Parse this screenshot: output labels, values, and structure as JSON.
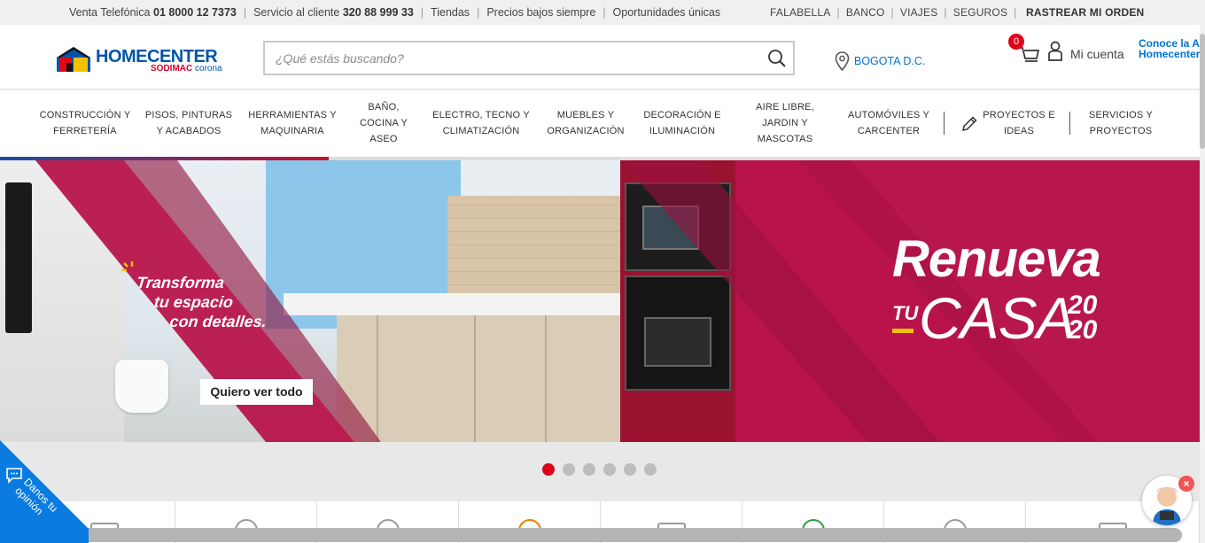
{
  "topbar": {
    "venta_label": "Venta Telefónica",
    "venta_number": "01 8000 12 7373",
    "servicio_label": "Servicio al cliente",
    "servicio_number": "320 88 999 33",
    "tiendas": "Tiendas",
    "precios": "Precios bajos siempre",
    "oportunidades": "Oportunidades únicas",
    "falabella": "FALABELLA",
    "banco": "BANCO",
    "viajes": "VIAJES",
    "seguros": "SEGUROS",
    "rastrear": "RASTREAR MI ORDEN"
  },
  "header": {
    "brand": "HOMECENTER",
    "brand_sub_1": "SODIMAC",
    "brand_sub_2": "corona",
    "search_placeholder": "¿Qué estás buscando?",
    "location": "BOGOTA D.C.",
    "cart_count": "0",
    "account": "Mi cuenta",
    "conoce_line1": "Conoce la A",
    "conoce_line2": "Homecenter"
  },
  "nav": {
    "items": [
      {
        "l1": "CONSTRUCCIÓN Y",
        "l2": "FERRETERÍA",
        "l3": ""
      },
      {
        "l1": "PISOS, PINTURAS",
        "l2": "Y ACABADOS",
        "l3": ""
      },
      {
        "l1": "HERRAMIENTAS Y",
        "l2": "MAQUINARIA",
        "l3": ""
      },
      {
        "l1": "BAÑO,",
        "l2": "COCINA Y",
        "l3": "ASEO"
      },
      {
        "l1": "ELECTRO, TECNO Y",
        "l2": "CLIMATIZACIÓN",
        "l3": ""
      },
      {
        "l1": "MUEBLES Y",
        "l2": "ORGANIZACIÓN",
        "l3": ""
      },
      {
        "l1": "DECORACIÓN E",
        "l2": "ILUMINACIÓN",
        "l3": ""
      },
      {
        "l1": "AIRE LIBRE,",
        "l2": "JARDIN Y",
        "l3": "MASCOTAS"
      },
      {
        "l1": "AUTOMÓVILES Y",
        "l2": "CARCENTER",
        "l3": ""
      },
      {
        "l1": "PROYECTOS E",
        "l2": "IDEAS",
        "l3": ""
      },
      {
        "l1": "SERVICIOS Y",
        "l2": "PROYECTOS",
        "l3": ""
      }
    ]
  },
  "banner": {
    "tag_line1": "Transforma",
    "tag_line2": "tu espacio",
    "tag_line3": "con detalles.",
    "cta": "Quiero ver todo",
    "headline": "Renueva",
    "tu": "TU",
    "casa": "CASA",
    "year_top": "20",
    "year_bottom": "20",
    "colors": {
      "magenta": "#b8134a",
      "yellow": "#f2c200",
      "red_progress": "#c8102e"
    },
    "carousel_slide": 1,
    "carousel_total": 6,
    "progress": 0.27
  },
  "feedback": {
    "label_line1": "Danos tu",
    "label_line2": "opinión",
    "color": "#0a7be0"
  },
  "assistant": {
    "close": "×"
  }
}
